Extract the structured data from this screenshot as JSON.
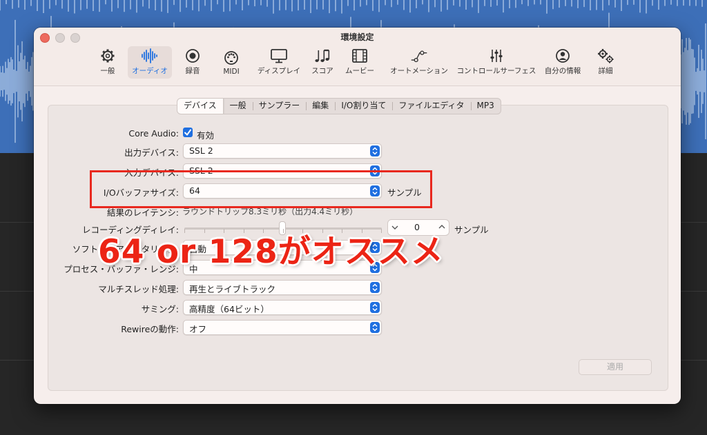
{
  "window": {
    "title": "環境設定"
  },
  "toolbar": {
    "items": [
      {
        "label": "一般",
        "icon": "gear-icon"
      },
      {
        "label": "オーディオ",
        "icon": "waveform-icon",
        "active": true
      },
      {
        "label": "録音",
        "icon": "record-icon"
      },
      {
        "label": "MIDI",
        "icon": "midi-icon"
      },
      {
        "label": "ディスプレイ",
        "icon": "display-icon"
      },
      {
        "label": "スコア",
        "icon": "music-notes-icon"
      },
      {
        "label": "ムービー",
        "icon": "film-icon"
      },
      {
        "label": "オートメーション",
        "icon": "automation-icon"
      },
      {
        "label": "コントロールサーフェス",
        "icon": "sliders-icon"
      },
      {
        "label": "自分の情報",
        "icon": "person-icon"
      },
      {
        "label": "詳細",
        "icon": "gears-icon"
      }
    ]
  },
  "tabs": [
    "デバイス",
    "一般",
    "サンプラー",
    "編集",
    "I/O割り当て",
    "ファイルエディタ",
    "MP3"
  ],
  "settings": {
    "core_audio": {
      "label": "Core Audio:",
      "checkbox_label": "有効",
      "checked": true
    },
    "output_device": {
      "label": "出力デバイス:",
      "value": "SSL 2"
    },
    "input_device": {
      "label": "入力デバイス:",
      "value": "SSL 2"
    },
    "io_buffer": {
      "label": "I/Oバッファサイズ:",
      "value": "64",
      "suffix": "サンプル"
    },
    "latency": {
      "label": "結果のレイテンシ:",
      "value": "ラウンドトリップ8.3ミリ秒（出力4.4ミリ秒）"
    },
    "recording_delay": {
      "label": "レコーディングディレイ:",
      "value": "0",
      "suffix": "サンプル"
    },
    "software_monitoring": {
      "label": "ソフトウェアモニタリング:",
      "value": "自動"
    },
    "process_buffer": {
      "label": "プロセス・バッファ・レンジ:",
      "value": "中"
    },
    "multithread": {
      "label": "マルチスレッド処理:",
      "value": "再生とライブトラック"
    },
    "summing": {
      "label": "サミング:",
      "value": "高精度（64ビット）"
    },
    "rewire": {
      "label": "Rewireの動作:",
      "value": "オフ"
    }
  },
  "apply_button": "適用",
  "annotation": {
    "text": "64 or 128がオススメ",
    "color": "#ec2415"
  },
  "colors": {
    "accent": "#1f6fe0",
    "waveform_bg": "#3d6fb8",
    "annotation_red": "#e8281e"
  }
}
